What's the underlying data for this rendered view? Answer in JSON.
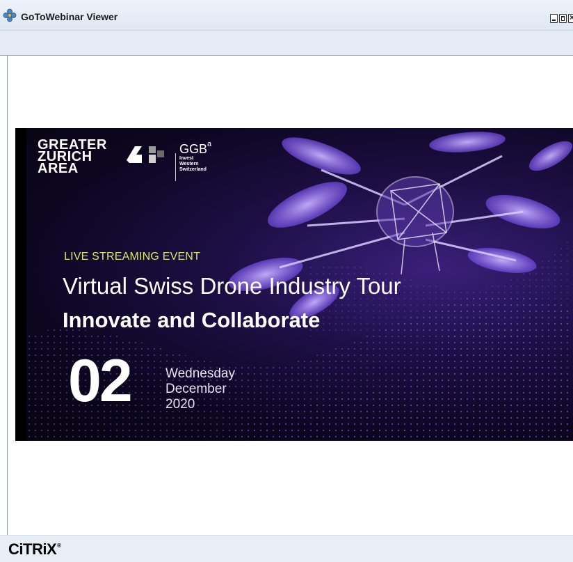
{
  "window": {
    "title": "GoToWebinar Viewer",
    "icon": "gotowebinar-flower-icon",
    "controls": [
      "minimize-icon",
      "maximize-icon",
      "close-icon"
    ]
  },
  "slide": {
    "logo_gza": [
      "GREATER",
      "ZURICH",
      "AREA"
    ],
    "logo_ggb": "GGB",
    "logo_ggb_superscript": "a",
    "logo_ggb_sub": [
      "Invest",
      "Western",
      "Switzerland"
    ],
    "event_label": "LIVE STREAMING EVENT",
    "headline": "Virtual Swiss Drone Industry Tour",
    "subheadline": "Innovate and Collaborate",
    "day": "02",
    "weekday": "Wednesday",
    "month": "December",
    "year": "2020",
    "colors": {
      "background": "#0c0620",
      "accent": "#d8ea6a",
      "drone": "#8f6cf0"
    }
  },
  "footer": {
    "brand": "CiTRiX",
    "brand_mark": "®"
  }
}
